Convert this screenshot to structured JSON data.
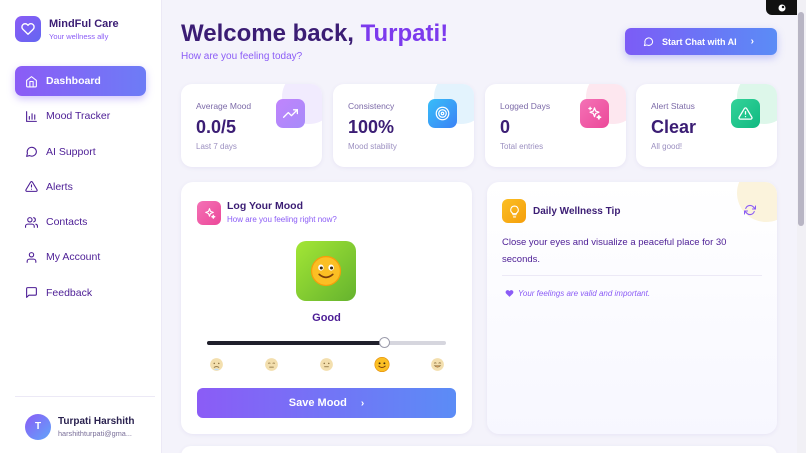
{
  "brand": {
    "name": "MindFul Care",
    "tagline": "Your wellness ally"
  },
  "nav": {
    "items": [
      {
        "label": "Dashboard",
        "icon": "home-icon",
        "active": true
      },
      {
        "label": "Mood Tracker",
        "icon": "bar-chart-icon"
      },
      {
        "label": "AI Support",
        "icon": "chat-bubble-icon"
      },
      {
        "label": "Alerts",
        "icon": "warning-icon"
      },
      {
        "label": "Contacts",
        "icon": "users-icon"
      },
      {
        "label": "My Account",
        "icon": "user-icon"
      },
      {
        "label": "Feedback",
        "icon": "message-square-icon"
      }
    ]
  },
  "user": {
    "initial": "T",
    "name": "Turpati Harshith",
    "email": "harshithturpati@gma..."
  },
  "header": {
    "greeting": "Welcome back,",
    "name": "Turpati!",
    "subtitle": "How are you feeling today?",
    "chat_button": "Start Chat with AI"
  },
  "stats": [
    {
      "label": "Average Mood",
      "value": "0.0/5",
      "note": "Last 7 days",
      "icon": "trending-up-icon",
      "color": "#a78bfa"
    },
    {
      "label": "Consistency",
      "value": "100%",
      "note": "Mood stability",
      "icon": "target-icon",
      "color": "#38bdf8"
    },
    {
      "label": "Logged Days",
      "value": "0",
      "note": "Total entries",
      "icon": "sparkles-icon",
      "color": "#f472b6"
    },
    {
      "label": "Alert Status",
      "value": "Clear",
      "note": "All good!",
      "icon": "alert-triangle-icon",
      "color": "#34d399"
    }
  ],
  "log": {
    "title": "Log Your Mood",
    "subtitle": "How are you feeling right now?",
    "mood_label": "Good",
    "slider_value": 0.74,
    "emojis": [
      "very-sad-face-icon",
      "sad-face-icon",
      "neutral-face-icon",
      "smiling-face-icon",
      "happy-face-icon"
    ],
    "selected_emoji": 3,
    "save_button": "Save Mood"
  },
  "tip": {
    "title": "Daily Wellness Tip",
    "text": "Close your eyes and visualize a peaceful place for 30 seconds.",
    "note": "Your feelings are valid and important."
  },
  "colors": {
    "accent": "#7c3aed",
    "accent_blue": "#5b8cf6",
    "heading": "#3b1d74"
  }
}
